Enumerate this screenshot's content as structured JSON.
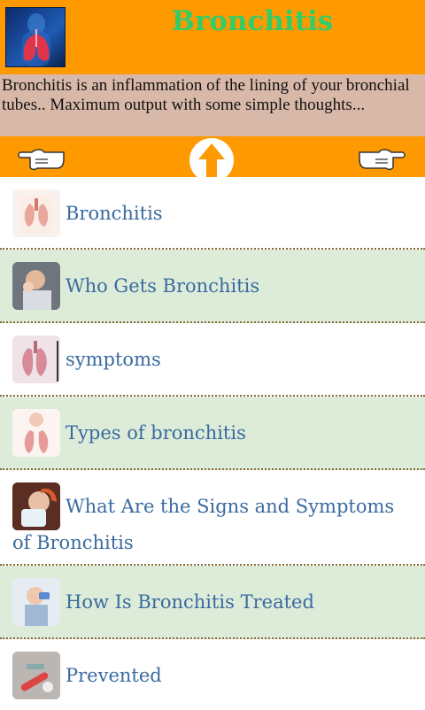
{
  "header": {
    "title": "Bronchitis"
  },
  "description": "Bronchitis is an inflammation of the lining of your bronchial tubes.. Maximum output with some simple thoughts...",
  "colors": {
    "orange": "#ff9900",
    "title_green": "#33cc66",
    "desc_bg": "#d8b8a8",
    "alt_row": "#dcecd8",
    "link_blue": "#3a6aa0"
  },
  "nav": {
    "left_icon": "pointing-hand-left-icon",
    "center_icon": "up-arrow-icon",
    "right_icon": "pointing-hand-right-icon"
  },
  "items": [
    {
      "label": "Bronchitis"
    },
    {
      "label": "Who Gets Bronchitis"
    },
    {
      "label": "symptoms"
    },
    {
      "label": "Types of bronchitis"
    },
    {
      "label": "What Are the Signs and Symptoms of Bronchitis"
    },
    {
      "label": "How Is Bronchitis Treated"
    },
    {
      "label": "Prevented"
    }
  ]
}
